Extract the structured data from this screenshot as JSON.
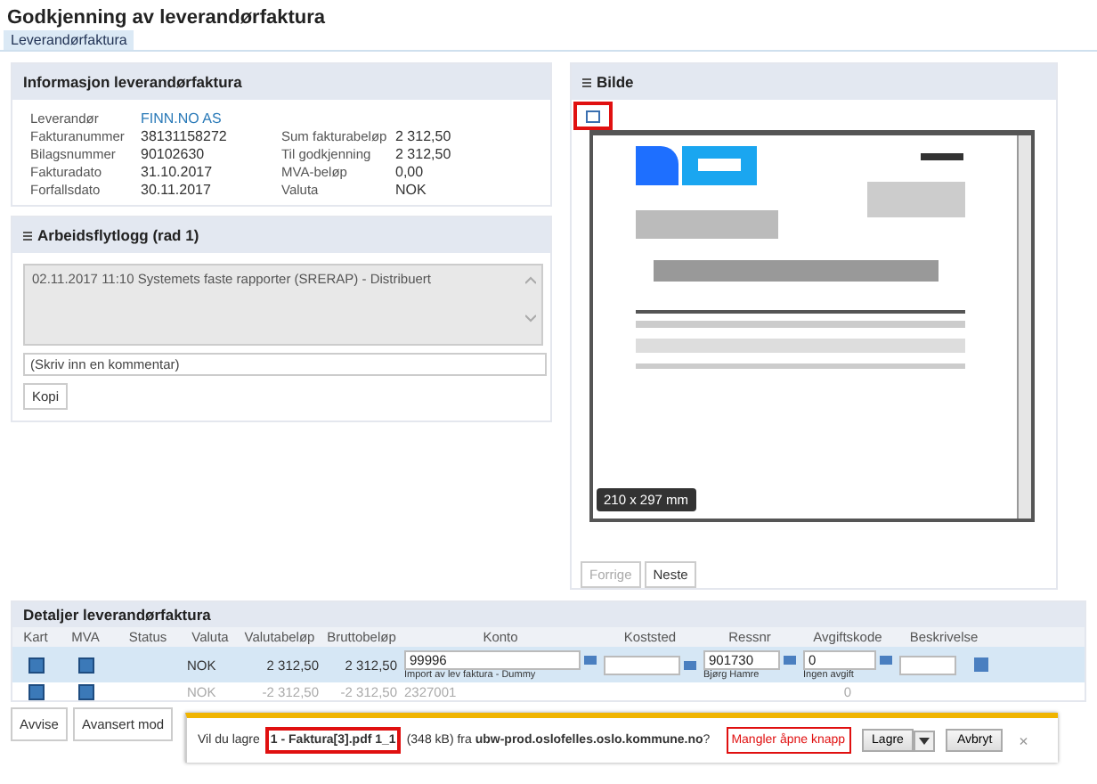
{
  "page": {
    "title": "Godkjenning av leverandørfaktura",
    "tabs": [
      {
        "label": "Leverandørfaktura",
        "selected": true
      }
    ]
  },
  "info_panel": {
    "title": "Informasjon leverandørfaktura",
    "left_fields": [
      {
        "label": "Leverandør",
        "value": "FINN.NO AS",
        "kind": "link"
      },
      {
        "label": "Fakturanummer",
        "value": "38131158272",
        "kind": "text"
      },
      {
        "label": "Bilagsnummer",
        "value": "90102630",
        "kind": "text"
      },
      {
        "label": "Fakturadato",
        "value": "31.10.2017",
        "kind": "text"
      },
      {
        "label": "Forfallsdato",
        "value": "30.11.2017",
        "kind": "text"
      }
    ],
    "right_fields": [
      {
        "label": "Sum fakturabeløp",
        "value": "2 312,50"
      },
      {
        "label": "Til godkjenning",
        "value": "2 312,50"
      },
      {
        "label": "MVA-beløp",
        "value": "0,00"
      },
      {
        "label": "Valuta",
        "value": "NOK"
      }
    ]
  },
  "workflow": {
    "title": "Arbeidsflytlogg (rad 1)",
    "log_text": "02.11.2017 11:10 Systemets faste rapporter (SRERAP) - Distribuert",
    "comment_placeholder": "(Skriv inn en kommentar)",
    "copy_button": "Kopi"
  },
  "image_panel": {
    "title": "Bilde",
    "size_label": "210 x 297 mm",
    "buttons": [
      {
        "label": "Forrige",
        "disabled": true
      },
      {
        "label": "Neste",
        "disabled": false
      }
    ]
  },
  "details": {
    "title": "Detaljer leverandørfaktura",
    "columns": [
      "Kart",
      "MVA",
      "Status",
      "Valuta",
      "Valutabeløp",
      "Bruttobeløp",
      "Konto",
      "Koststed",
      "Ressnr",
      "Avgiftskode",
      "Beskrivelse"
    ],
    "rows": [
      {
        "selected": true,
        "valuta": "NOK",
        "valutabelop": "2 312,50",
        "bruttobelop": "2 312,50",
        "konto": "99996",
        "konto_sub": "Import av lev faktura - Dummy",
        "ressnr": "901730",
        "ressnr_sub": "Bjørg Hamre",
        "avgiftskode": "0",
        "avgiftskode_sub": "Ingen avgift"
      },
      {
        "selected": false,
        "valuta": "NOK",
        "valutabelop": "-2 312,50",
        "bruttobelop": "-2 312,50",
        "konto": "2327001",
        "konto_sub": "",
        "ressnr": "",
        "ressnr_sub": "",
        "avgiftskode": "0",
        "avgiftskode_sub": ""
      }
    ]
  },
  "actions": [
    "Avvise",
    "Avansert mod"
  ],
  "download_bar": {
    "prefix": "Vil du lagre",
    "filename": "1 - Faktura[3].pdf 1_1",
    "suffix": "(348 kB) fra **ubw-prod.oslofelles.oslo.kommune.no**?",
    "note": "Mangler åpne knapp",
    "save_button": "Lagre",
    "cancel_button": "Avbryt",
    "close": "×"
  }
}
